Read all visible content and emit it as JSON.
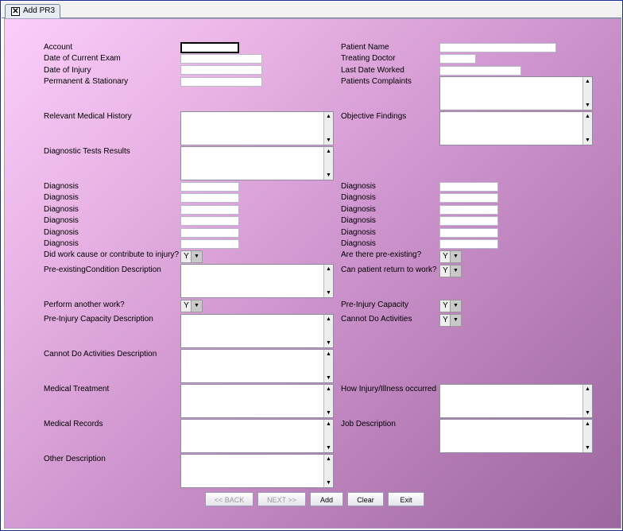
{
  "tab": {
    "title": "Add PR3",
    "close_glyph": "✕"
  },
  "left_fields": {
    "account": "Account",
    "date_exam": "Date of Current Exam",
    "date_injury": "Date of Injury",
    "perm_stat": "Permanent & Stationary",
    "rel_history": "Relevant Medical History",
    "diag_tests": "Diagnostic Tests Results",
    "diagnosis": "Diagnosis",
    "work_cause": "Did work cause or contribute to injury?",
    "preexisting_desc": "Pre-existingCondition Description",
    "perform_work": "Perform another work?",
    "preinjury_desc": "Pre-Injury Capacity Description",
    "cannot_do_desc": "Cannot Do Activities Description",
    "medical_treatment": "Medical Treatment",
    "medical_records": "Medical Records",
    "other_desc": "Other Description"
  },
  "right_fields": {
    "patient_name": "Patient Name",
    "treating_doctor": "Treating Doctor",
    "last_date": "Last Date Worked",
    "complaints": "Patients Complaints",
    "objective": "Objective Findings",
    "diagnosis": "Diagnosis",
    "preexisting": "Are there pre-existing?",
    "return_work": "Can patient return to work?",
    "preinjury_cap": "Pre-Injury Capacity",
    "cannot_do": "Cannot Do Activities",
    "how_injury": "How Injury/Illness occurred",
    "job_desc": "Job Description"
  },
  "combo_value": "Y",
  "glyphs": {
    "up": "▲",
    "down": "▼"
  },
  "buttons": {
    "back": "<< BACK",
    "next": "NEXT >>",
    "add": "Add",
    "clear": "Clear",
    "exit": "Exit"
  }
}
